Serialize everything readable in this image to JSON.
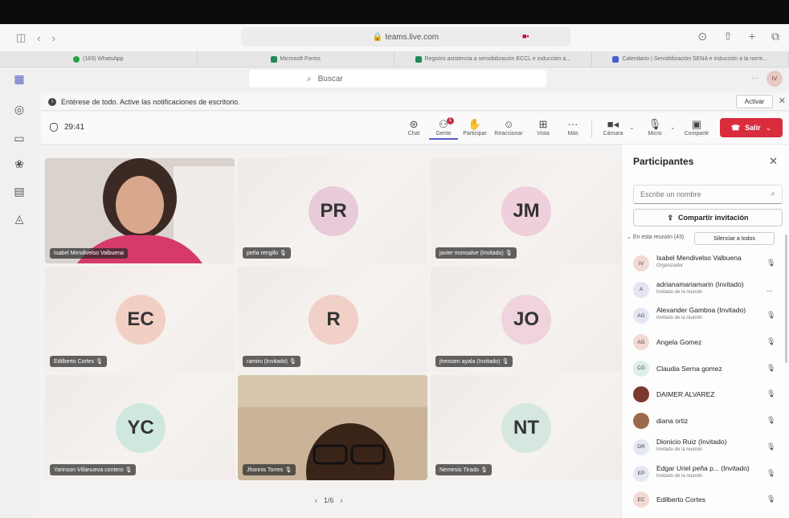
{
  "browser": {
    "url": "teams.live.com",
    "tabs": [
      {
        "label": "(183) WhatsApp",
        "color": "#25a244"
      },
      {
        "label": "Microsoft Forms",
        "color": "#1f8a5a"
      },
      {
        "label": "Registro asistencia a sensibilización ECCL e inducción a...",
        "color": "#1f8a5a"
      },
      {
        "label": "Calendario | Sensibilización SENA e inducción a la norm...",
        "color": "#4a5bd0"
      }
    ]
  },
  "teams": {
    "search_placeholder": "Buscar",
    "top_avatar": "IV"
  },
  "notification": {
    "text": "Entérese de todo. Active las notificaciones de escritorio.",
    "activate_label": "Activar"
  },
  "meeting": {
    "timer": "29:41",
    "toolbar": {
      "chat": "Chat",
      "people": "Gente",
      "raise": "Participar",
      "react": "Reaccionar",
      "view": "Vista",
      "more": "Más",
      "camera": "Cámara",
      "mic": "Micro",
      "share": "Compartir",
      "leave": "Salir",
      "people_badge": "1"
    },
    "pager": "1/6",
    "tiles": [
      {
        "name": "Isabel Mendivelso Valbuena",
        "initials": "",
        "color": "#ffffff",
        "video": true
      },
      {
        "name": "peña rengifo",
        "initials": "PR",
        "color": "#e7cbd8"
      },
      {
        "name": "javier monsalve (Invitado)",
        "initials": "JM",
        "color": "#efcfdb"
      },
      {
        "name": "Edilberto Cortes",
        "initials": "EC",
        "color": "#f2cfc4"
      },
      {
        "name": "ramiro (Invitado)",
        "initials": "R",
        "color": "#f1d0c7"
      },
      {
        "name": "jheissen ayala (Invitado)",
        "initials": "JO",
        "color": "#f0d3dd"
      },
      {
        "name": "Yarinson Villanueva contero",
        "initials": "YC",
        "color": "#cfe8df"
      },
      {
        "name": "Jhonnis Torres",
        "initials": "",
        "color": "#ffffff",
        "video": true
      },
      {
        "name": "Nemesio Tirado",
        "initials": "NT",
        "color": "#d5e7df"
      }
    ]
  },
  "participants": {
    "title": "Participantes",
    "search_placeholder": "Escribe un nombre",
    "share_invite": "Compartir invitación",
    "in_meeting": "En esta reunión (43)",
    "mute_all": "Silenciar a todos",
    "list": [
      {
        "initials": "IV",
        "name": "Isabel Mendivelso Valbuena",
        "role": "Organizador",
        "color": "#f1d9d4",
        "icon": "🎙"
      },
      {
        "initials": "A",
        "name": "adrianamariamarin (Invitado)",
        "role": "Invitado de la reunión",
        "color": "#e4e4f3",
        "icon": "..."
      },
      {
        "initials": "AG",
        "name": "Alexander Gamboa (Invitado)",
        "role": "Invitado de la reunión",
        "color": "#e4e8f3",
        "icon": "🎙"
      },
      {
        "initials": "AG",
        "name": "Angela Gomez",
        "role": "",
        "color": "#f3d9d4",
        "icon": "🎙"
      },
      {
        "initials": "CG",
        "name": "Claudia Serna gomez",
        "role": "",
        "color": "#dcefe8",
        "icon": "🎙"
      },
      {
        "initials": "",
        "name": "DAIMER ALVAREZ",
        "role": "",
        "color": "#7a3b2e",
        "icon": "🎙"
      },
      {
        "initials": "",
        "name": "diana ortiz",
        "role": "",
        "color": "#9a6a4a",
        "icon": "🎙"
      },
      {
        "initials": "DR",
        "name": "Dionicio Ruiz (Invitado)",
        "role": "Invitado de la reunión",
        "color": "#e4e8f3",
        "icon": "🎙"
      },
      {
        "initials": "EP",
        "name": "Edgar Uriel peña p... (Invitado)",
        "role": "Invitado de la reunión",
        "color": "#e4e8f3",
        "icon": "🎙"
      },
      {
        "initials": "EC",
        "name": "Edilberto Cortes",
        "role": "",
        "color": "#f3d9d4",
        "icon": "🎙"
      }
    ]
  }
}
